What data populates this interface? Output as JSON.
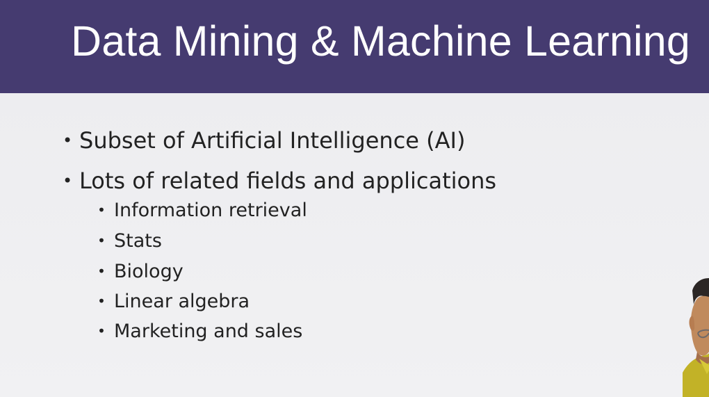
{
  "slide": {
    "title": "Data Mining & Machine Learning",
    "bullets": [
      {
        "text": "Subset of Artificial Intelligence (AI)"
      },
      {
        "text": "Lots of related fields and applications",
        "sub_bullets": [
          "Information retrieval",
          "Stats",
          "Biology",
          "Linear algebra",
          "Marketing and sales"
        ]
      }
    ]
  },
  "colors": {
    "title_bar": "#453b70",
    "title_text": "#ffffff",
    "background": "#efeff1",
    "body_text": "#222222"
  },
  "icons": {
    "bullet": "•"
  }
}
